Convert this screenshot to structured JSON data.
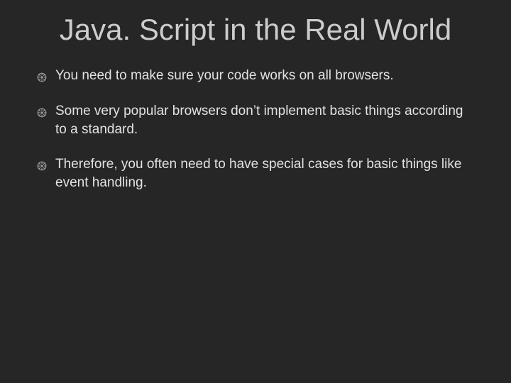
{
  "slide": {
    "title": "Java. Script in the Real World",
    "bullets": [
      "You need to make sure your code works on all browsers.",
      "Some very popular browsers don’t implement basic things according to a standard.",
      "Therefore, you often need to have special cases for basic things like event handling."
    ]
  }
}
